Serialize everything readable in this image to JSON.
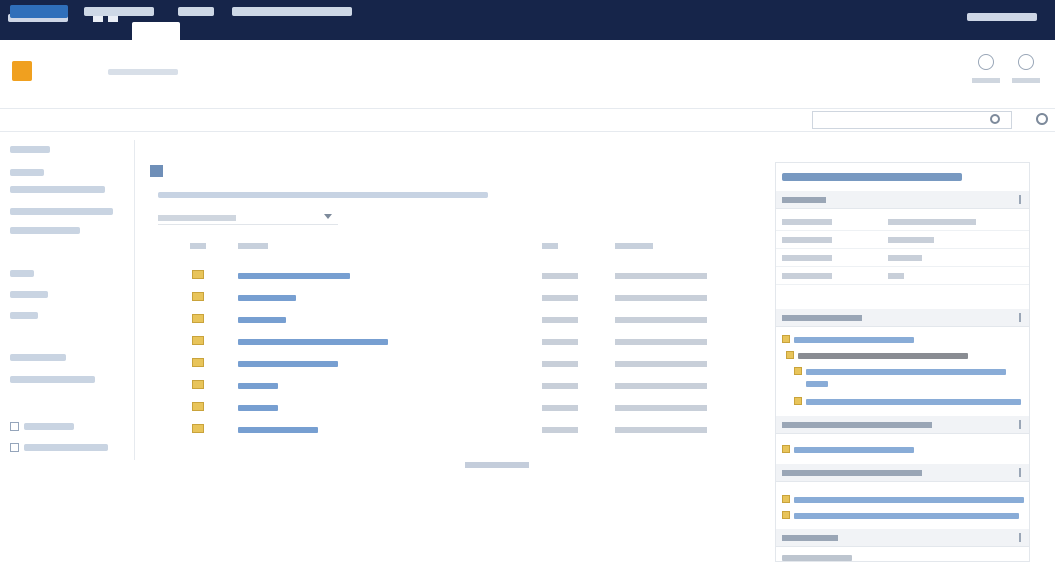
{
  "topbar": {
    "brand_label": "",
    "tabs": [
      {
        "label": ""
      },
      {
        "label": ""
      }
    ],
    "user_label": ""
  },
  "header": {
    "site_title": "",
    "breadcrumb": "",
    "actions": [
      {
        "label": ""
      },
      {
        "label": ""
      }
    ]
  },
  "nav": {
    "items": [
      {
        "label": ""
      },
      {
        "label": ""
      },
      {
        "label": ""
      },
      {
        "label": ""
      }
    ],
    "search_placeholder": ""
  },
  "leftnav": {
    "items": [
      {
        "label": ""
      },
      {
        "label": ""
      },
      {
        "label": ""
      },
      {
        "label": ""
      },
      {
        "label": ""
      },
      {
        "label": ""
      },
      {
        "label": ""
      },
      {
        "label": ""
      },
      {
        "label": ""
      },
      {
        "label": ""
      },
      {
        "label": ""
      },
      {
        "label": ""
      }
    ]
  },
  "library": {
    "title": "",
    "path": "",
    "view_label": "",
    "columns": [
      "",
      "",
      "",
      ""
    ],
    "rows": [
      {
        "name": "",
        "size": "",
        "modified": ""
      },
      {
        "name": "",
        "size": "",
        "modified": ""
      },
      {
        "name": "",
        "size": "",
        "modified": ""
      },
      {
        "name": "",
        "size": "",
        "modified": ""
      },
      {
        "name": "",
        "size": "",
        "modified": ""
      },
      {
        "name": "",
        "size": "",
        "modified": ""
      },
      {
        "name": "",
        "size": "",
        "modified": ""
      },
      {
        "name": "",
        "size": "",
        "modified": ""
      }
    ],
    "pager": ""
  },
  "panel": {
    "title": "",
    "sections": [
      {
        "label": ""
      },
      {
        "label": ""
      },
      {
        "label": ""
      },
      {
        "label": ""
      },
      {
        "label": ""
      }
    ],
    "properties": [
      {
        "key": "",
        "value": ""
      },
      {
        "key": "",
        "value": ""
      },
      {
        "key": "",
        "value": ""
      },
      {
        "key": "",
        "value": ""
      }
    ]
  }
}
